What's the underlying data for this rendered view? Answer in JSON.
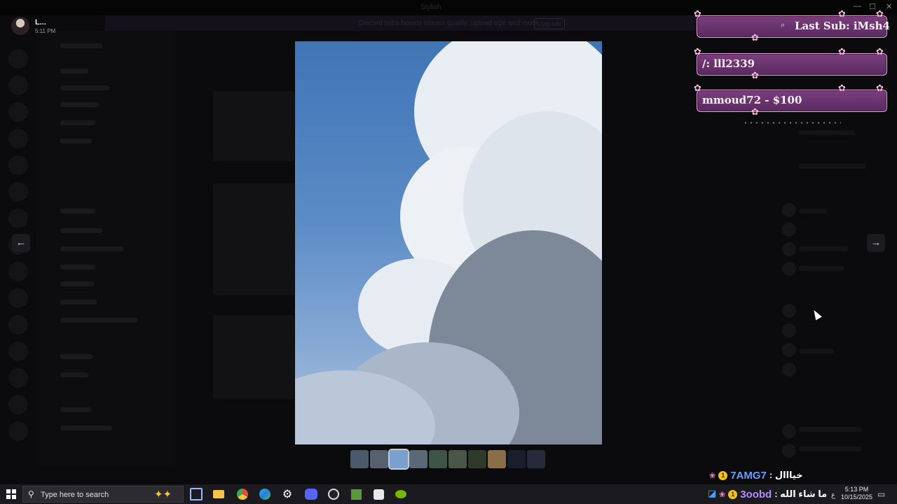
{
  "window": {
    "title": "Stylish",
    "minimize": "—",
    "maximize": "☐",
    "close": "✕"
  },
  "banner": {
    "text": "Discord Nitro boosts stream quality, upload size and more.",
    "button": "Upgrade"
  },
  "viewer": {
    "user_name": "L...",
    "timestamp": "5:11 PM",
    "prev_icon": "arrow-left-icon",
    "next_icon": "arrow-right-icon",
    "prev_glyph": "←",
    "next_glyph": "→",
    "thumbnail_count": 10,
    "active_thumbnail": 3
  },
  "overlay": {
    "alerts": [
      {
        "text": "Last Sub: iMsh4"
      },
      {
        "text": "/: lll2339"
      },
      {
        "text": "mmoud72 - $100"
      }
    ],
    "chat": [
      {
        "user": "7AMG7",
        "message": ": خيااال"
      },
      {
        "user": "3oobd",
        "message": ": ما شاء الله"
      }
    ]
  },
  "taskbar": {
    "search_placeholder": "Type here to search",
    "time": "5:13 PM",
    "date": "10/15/2025",
    "lang": "ع"
  },
  "colors": {
    "alert_fill": "#6a3470",
    "alert_border": "#e6a8d8",
    "chat_user_blue": "#6a9cff",
    "chat_user_purple": "#b58cff",
    "sky": "#4a7fc0"
  }
}
